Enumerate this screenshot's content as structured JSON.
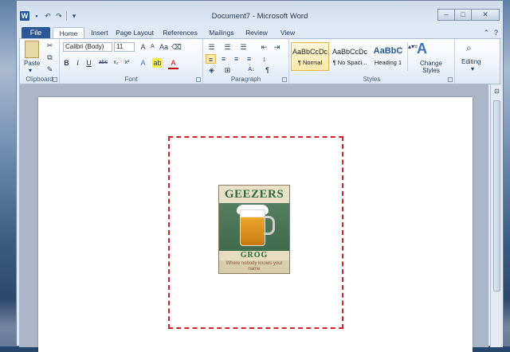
{
  "window": {
    "title": "Document7 - Microsoft Word"
  },
  "tabs": [
    {
      "label": "File"
    },
    {
      "label": "Home"
    },
    {
      "label": "Insert"
    },
    {
      "label": "Page Layout"
    },
    {
      "label": "References"
    },
    {
      "label": "Mailings"
    },
    {
      "label": "Review"
    },
    {
      "label": "View"
    }
  ],
  "clipboard": {
    "paste_label": "Paste",
    "group_label": "Clipboard"
  },
  "font": {
    "name": "Calibri (Body)",
    "size": "11",
    "group_label": "Font"
  },
  "paragraph": {
    "group_label": "Paragraph"
  },
  "styles": {
    "items": [
      {
        "sample": "AaBbCcDc",
        "name": "¶ Normal"
      },
      {
        "sample": "AaBbCcDc",
        "name": "¶ No Spaci..."
      },
      {
        "sample": "AaBbC",
        "name": "Heading 1"
      }
    ],
    "change_styles_label": "Change Styles",
    "group_label": "Styles"
  },
  "editing": {
    "label": "Editing"
  },
  "sign": {
    "title": "GEEZERS",
    "subtitle": "GROG",
    "tagline": "Where nobody knows your name"
  },
  "colors": {
    "file_tab": "#2b5797",
    "dashed_border": "#d62027"
  },
  "icons": [
    "word-logo",
    "save-icon",
    "undo-icon",
    "redo-icon",
    "qat-customize-icon",
    "minimize-icon",
    "maximize-icon",
    "close-icon",
    "help-icon",
    "collapse-ribbon-icon"
  ]
}
